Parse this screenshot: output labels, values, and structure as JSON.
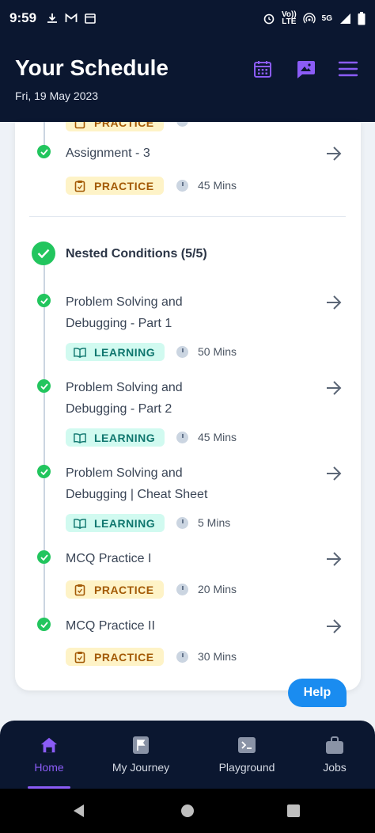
{
  "status_bar": {
    "time": "9:59",
    "volte": "Vo))",
    "lte": "LTE",
    "net": "5G"
  },
  "header": {
    "title": "Your Schedule",
    "date": "Fri, 19 May 2023"
  },
  "top_partial": {
    "badge": "PRACTICE"
  },
  "assignment": {
    "title": "Assignment - 3",
    "badge": "PRACTICE",
    "duration": "45 Mins"
  },
  "section": {
    "title": "Nested Conditions (5/5)",
    "items": [
      {
        "title": "Problem Solving and Debugging - Part 1",
        "badge": "LEARNING",
        "duration": "50 Mins"
      },
      {
        "title": "Problem Solving and Debugging - Part 2",
        "badge": "LEARNING",
        "duration": "45 Mins"
      },
      {
        "title": "Problem Solving and Debugging | Cheat Sheet",
        "badge": "LEARNING",
        "duration": "5 Mins"
      },
      {
        "title": "MCQ Practice I",
        "badge": "PRACTICE",
        "duration": "20 Mins"
      },
      {
        "title": "MCQ Practice II",
        "badge": "PRACTICE",
        "duration": "30 Mins"
      }
    ]
  },
  "help": {
    "label": "Help"
  },
  "nav": {
    "items": [
      {
        "label": "Home",
        "icon": "home-icon"
      },
      {
        "label": "My Journey",
        "icon": "flag-icon"
      },
      {
        "label": "Playground",
        "icon": "terminal-icon"
      },
      {
        "label": "Jobs",
        "icon": "briefcase-icon"
      }
    ]
  },
  "colors": {
    "accent": "#8b5cf6",
    "success": "#22c55e",
    "header_bg": "#0b1730",
    "help": "#1a8cf0"
  }
}
